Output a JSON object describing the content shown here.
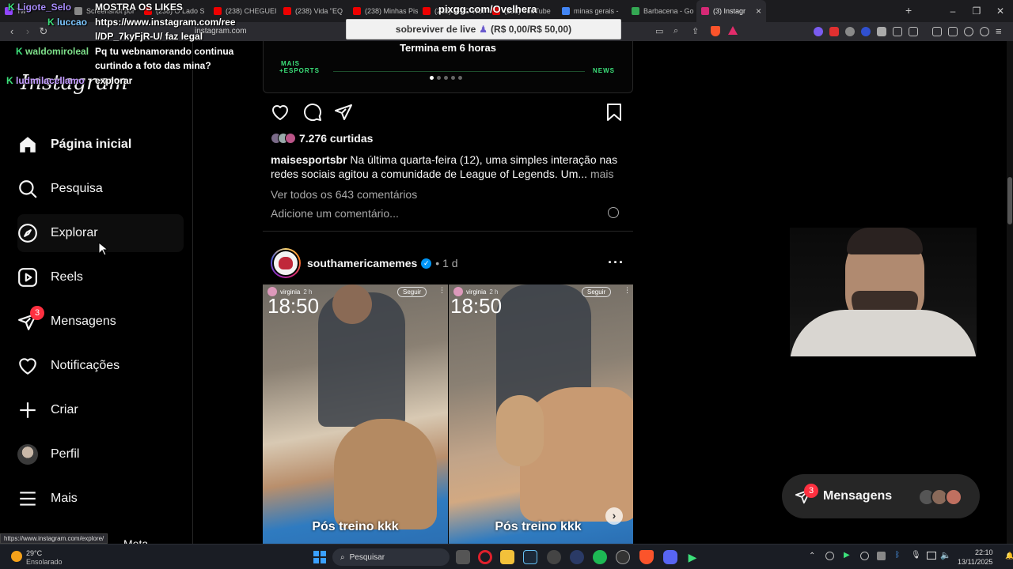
{
  "browser": {
    "tabs": [
      {
        "label": "Tw",
        "color": "#9146ff"
      },
      {
        "label": "Screenshot por",
        "color": "#888"
      },
      {
        "label": "(238) O Lado S",
        "color": "#e00"
      },
      {
        "label": "(238) CHEGUEI",
        "color": "#e00"
      },
      {
        "label": "(238) Vida \"EQ",
        "color": "#e00"
      },
      {
        "label": "(238) Minhas Pis",
        "color": "#e00"
      },
      {
        "label": "(238) EPIC Wor",
        "color": "#e00"
      },
      {
        "label": "(238) YouTube",
        "color": "#e00"
      },
      {
        "label": "minas gerais -",
        "color": "#4285f4"
      },
      {
        "label": "Barbacena - Go",
        "color": "#34a853"
      },
      {
        "label": "(3) Instagr",
        "color": "#d62976",
        "active": true
      }
    ],
    "url": "instagram.com",
    "status_url": "https://www.instagram.com/explore/"
  },
  "stream_overlay": {
    "pix_title": "pixgg.com/Ovelhera",
    "goal_text": "sobreviver de live",
    "goal_amount": "(R$ 0,00/R$ 50,00)",
    "chat": [
      {
        "name": "Ligote_Selo",
        "msg": "MOSTRA OS LIKES"
      },
      {
        "name": "luccao",
        "msg": "https://www.instagram.com/ree"
      },
      {
        "name": "",
        "msg": "l/DP_7kyFjR-U/ faz legal"
      },
      {
        "name": "waldomiroleal",
        "msg": "Pq tu webnamorando continua"
      },
      {
        "name": "",
        "msg": "curtindo a foto das mina?"
      },
      {
        "name": "ludmilacellamo",
        "msg": "explorar"
      }
    ]
  },
  "instagram": {
    "logo": "Instagram",
    "nav": [
      {
        "label": "Página inicial",
        "icon": "home-icon",
        "bold": true
      },
      {
        "label": "Pesquisa",
        "icon": "search-icon"
      },
      {
        "label": "Explorar",
        "icon": "compass-icon"
      },
      {
        "label": "Reels",
        "icon": "reels-icon"
      },
      {
        "label": "Mensagens",
        "icon": "messenger-icon",
        "badge": "3"
      },
      {
        "label": "Notificações",
        "icon": "heart-icon"
      },
      {
        "label": "Criar",
        "icon": "plus-icon"
      },
      {
        "label": "Perfil",
        "icon": "avatar"
      },
      {
        "label": "Mais",
        "icon": "menu-icon"
      }
    ],
    "more_partial": "Meta",
    "promo": {
      "countdown": "Termina em 6 horas",
      "brand_left_1": "MAIS",
      "brand_left_2": "+ESPORTS",
      "brand_right": "NEWS"
    },
    "post1": {
      "likes": "7.276 curtidas",
      "username": "maisesportsbr",
      "caption": "Na última quarta-feira (12), uma simples interação nas redes sociais agitou a comunidade de League of Legends. Um...",
      "more": "mais",
      "comments_link": "Ver todos os 643 comentários",
      "comment_placeholder": "Adicione um comentário..."
    },
    "post2": {
      "username": "southamericamemes",
      "time": "• 1 d",
      "story_user": "virginia",
      "story_age": "2 h",
      "follow": "Seguir",
      "clock": "18:50",
      "caption_overlay": "Pós treino kkk"
    },
    "messages_bar": {
      "label": "Mensagens",
      "badge": "3"
    }
  },
  "taskbar": {
    "weather_temp": "29°C",
    "weather_desc": "Ensolarado",
    "search": "Pesquisar",
    "time": "22:10",
    "date": "13/11/2025"
  }
}
